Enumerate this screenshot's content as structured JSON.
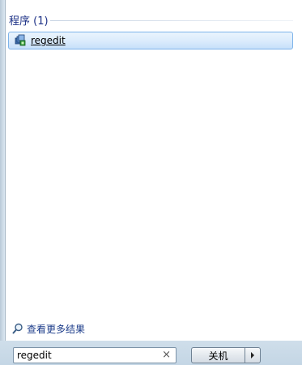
{
  "results": {
    "section_title": "程序 (1)",
    "items": [
      {
        "label": "regedit",
        "icon": "regedit-icon"
      }
    ]
  },
  "see_more": {
    "label": "查看更多结果",
    "icon": "search-icon"
  },
  "search": {
    "value": "regedit",
    "clear_glyph": "×"
  },
  "shutdown": {
    "label": "关机",
    "arrow_glyph": "▸"
  }
}
